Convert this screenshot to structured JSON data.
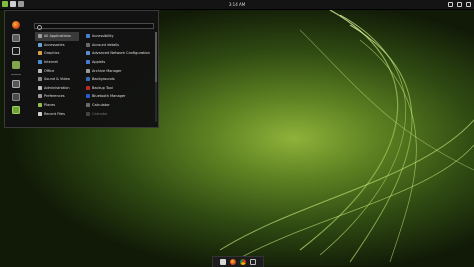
{
  "top_panel": {
    "clock": "3:14 AM",
    "left_icons": [
      "mint-menu-icon",
      "network-icon",
      "chat-icon"
    ],
    "right_icons": [
      "sound-icon",
      "battery-icon",
      "shutdown-icon"
    ]
  },
  "menu": {
    "search_placeholder": "",
    "favorites": [
      "firefox-icon",
      "settings-icon",
      "terminal-icon",
      "files-icon",
      "lock-icon",
      "logout-icon",
      "power-icon"
    ],
    "categories": [
      {
        "label": "All Applications",
        "icon": "grid-icon",
        "color": "#9c9c9c",
        "selected": true
      },
      {
        "label": "Accessories",
        "icon": "accessories-icon",
        "color": "#6aa1d8"
      },
      {
        "label": "Graphics",
        "icon": "graphics-icon",
        "color": "#d2a24a"
      },
      {
        "label": "Internet",
        "icon": "internet-icon",
        "color": "#4a8fd6"
      },
      {
        "label": "Office",
        "icon": "office-icon",
        "color": "#b8b8b8"
      },
      {
        "label": "Sound & Video",
        "icon": "multimedia-icon",
        "color": "#8a8a8a"
      },
      {
        "label": "Administration",
        "icon": "administration-icon",
        "color": "#c0c0c0"
      },
      {
        "label": "Preferences",
        "icon": "preferences-icon",
        "color": "#9a9a9a"
      },
      {
        "label": "Places",
        "icon": "places-icon",
        "color": "#8fbf4a"
      },
      {
        "label": "Recent Files",
        "icon": "recent-files-icon",
        "color": "#d0d0d0"
      }
    ],
    "apps": [
      {
        "label": "Accessibility",
        "icon": "accessibility-icon",
        "color": "#4a7fd0"
      },
      {
        "label": "Account details",
        "icon": "account-icon",
        "color": "#6a6a6a"
      },
      {
        "label": "Advanced Network Configuration",
        "icon": "network-config-icon",
        "color": "#5a8ad0"
      },
      {
        "label": "Applets",
        "icon": "applets-icon",
        "color": "#4a7ad0"
      },
      {
        "label": "Archive Manager",
        "icon": "archive-icon",
        "color": "#9a9a9a"
      },
      {
        "label": "Backgrounds",
        "icon": "backgrounds-icon",
        "color": "#3a6ab0"
      },
      {
        "label": "Backup Tool",
        "icon": "backup-icon",
        "color": "#c02828"
      },
      {
        "label": "Bluetooth Manager",
        "icon": "bluetooth-icon",
        "color": "#2a5ad0"
      },
      {
        "label": "Calculator",
        "icon": "calculator-icon",
        "color": "#6a6a6a"
      },
      {
        "label": "Calendar",
        "icon": "calendar-icon",
        "color": "#444444",
        "dim": true
      }
    ]
  },
  "dock": [
    "files-icon",
    "firefox-icon",
    "chrome-icon",
    "terminal-icon"
  ]
}
